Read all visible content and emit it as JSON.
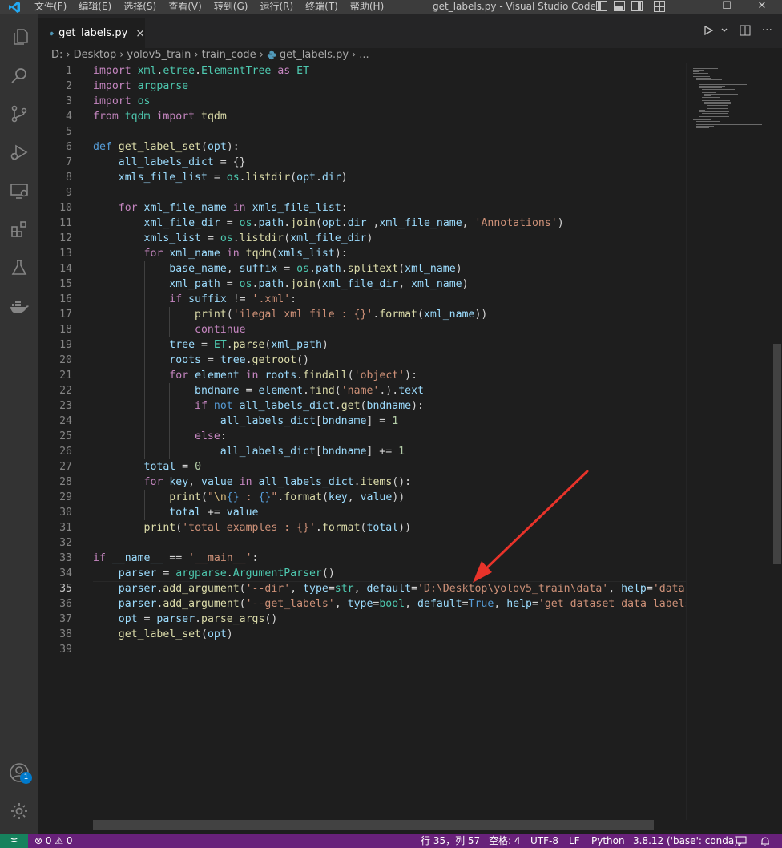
{
  "titlebar": {
    "menus": [
      "文件(F)",
      "编辑(E)",
      "选择(S)",
      "查看(V)",
      "转到(G)",
      "运行(R)",
      "终端(T)",
      "帮助(H)"
    ],
    "title": "get_labels.py - Visual Studio Code",
    "icons": [
      "vscode-logo-icon",
      "toggle-sidebar-icon",
      "toggle-panel-icon",
      "toggle-secondary-sidebar-icon",
      "customize-layout-icon",
      "minimize-icon",
      "maximize-icon",
      "close-icon"
    ]
  },
  "activitybar": {
    "items": [
      "explorer-icon",
      "search-icon",
      "source-control-icon",
      "run-debug-icon",
      "remote-explorer-icon",
      "extensions-icon",
      "testing-icon",
      "docker-icon"
    ],
    "bottom": [
      "accounts-icon",
      "manage-gear-icon"
    ],
    "accounts_badge": "1"
  },
  "tab": {
    "label": "get_labels.py",
    "close": "×"
  },
  "breadcrumb": [
    "D:",
    "Desktop",
    "yolov5_train",
    "train_code",
    "get_labels.py",
    "..."
  ],
  "editor": {
    "current_line": 35
  },
  "code_lines": [
    [
      [
        "kw",
        "import"
      ],
      [
        "pl",
        " "
      ],
      [
        "cls",
        "xml"
      ],
      [
        "pl",
        "."
      ],
      [
        "cls",
        "etree"
      ],
      [
        "pl",
        "."
      ],
      [
        "cls",
        "ElementTree"
      ],
      [
        "pl",
        " "
      ],
      [
        "kw",
        "as"
      ],
      [
        "pl",
        " "
      ],
      [
        "cls",
        "ET"
      ]
    ],
    [
      [
        "kw",
        "import"
      ],
      [
        "pl",
        " "
      ],
      [
        "cls",
        "argparse"
      ]
    ],
    [
      [
        "kw",
        "import"
      ],
      [
        "pl",
        " "
      ],
      [
        "cls",
        "os"
      ]
    ],
    [
      [
        "kw",
        "from"
      ],
      [
        "pl",
        " "
      ],
      [
        "cls",
        "tqdm"
      ],
      [
        "pl",
        " "
      ],
      [
        "kw",
        "import"
      ],
      [
        "pl",
        " "
      ],
      [
        "fn",
        "tqdm"
      ]
    ],
    [],
    [
      [
        "kw2",
        "def"
      ],
      [
        "pl",
        " "
      ],
      [
        "fn",
        "get_label_set"
      ],
      [
        "pl",
        "("
      ],
      [
        "var",
        "opt"
      ],
      [
        "pl",
        "):"
      ]
    ],
    [
      [
        "pl",
        "    "
      ],
      [
        "var",
        "all_labels_dict"
      ],
      [
        "pl",
        " = {}"
      ]
    ],
    [
      [
        "pl",
        "    "
      ],
      [
        "var",
        "xmls_file_list"
      ],
      [
        "pl",
        " = "
      ],
      [
        "cls",
        "os"
      ],
      [
        "pl",
        "."
      ],
      [
        "fn",
        "listdir"
      ],
      [
        "pl",
        "("
      ],
      [
        "var",
        "opt"
      ],
      [
        "pl",
        "."
      ],
      [
        "var",
        "dir"
      ],
      [
        "pl",
        ")"
      ]
    ],
    [],
    [
      [
        "pl",
        "    "
      ],
      [
        "kw",
        "for"
      ],
      [
        "pl",
        " "
      ],
      [
        "var",
        "xml_file_name"
      ],
      [
        "pl",
        " "
      ],
      [
        "kw",
        "in"
      ],
      [
        "pl",
        " "
      ],
      [
        "var",
        "xmls_file_list"
      ],
      [
        "pl",
        ":"
      ]
    ],
    [
      [
        "pl",
        "        "
      ],
      [
        "var",
        "xml_file_dir"
      ],
      [
        "pl",
        " = "
      ],
      [
        "cls",
        "os"
      ],
      [
        "pl",
        "."
      ],
      [
        "var",
        "path"
      ],
      [
        "pl",
        "."
      ],
      [
        "fn",
        "join"
      ],
      [
        "pl",
        "("
      ],
      [
        "var",
        "opt"
      ],
      [
        "pl",
        "."
      ],
      [
        "var",
        "dir"
      ],
      [
        "pl",
        " ,"
      ],
      [
        "var",
        "xml_file_name"
      ],
      [
        "pl",
        ", "
      ],
      [
        "str",
        "'Annotations'"
      ],
      [
        "pl",
        ")"
      ]
    ],
    [
      [
        "pl",
        "        "
      ],
      [
        "var",
        "xmls_list"
      ],
      [
        "pl",
        " = "
      ],
      [
        "cls",
        "os"
      ],
      [
        "pl",
        "."
      ],
      [
        "fn",
        "listdir"
      ],
      [
        "pl",
        "("
      ],
      [
        "var",
        "xml_file_dir"
      ],
      [
        "pl",
        ")"
      ]
    ],
    [
      [
        "pl",
        "        "
      ],
      [
        "kw",
        "for"
      ],
      [
        "pl",
        " "
      ],
      [
        "var",
        "xml_name"
      ],
      [
        "pl",
        " "
      ],
      [
        "kw",
        "in"
      ],
      [
        "pl",
        " "
      ],
      [
        "fn",
        "tqdm"
      ],
      [
        "pl",
        "("
      ],
      [
        "var",
        "xmls_list"
      ],
      [
        "pl",
        "):"
      ]
    ],
    [
      [
        "pl",
        "            "
      ],
      [
        "var",
        "base_name"
      ],
      [
        "pl",
        ", "
      ],
      [
        "var",
        "suffix"
      ],
      [
        "pl",
        " = "
      ],
      [
        "cls",
        "os"
      ],
      [
        "pl",
        "."
      ],
      [
        "var",
        "path"
      ],
      [
        "pl",
        "."
      ],
      [
        "fn",
        "splitext"
      ],
      [
        "pl",
        "("
      ],
      [
        "var",
        "xml_name"
      ],
      [
        "pl",
        ")"
      ]
    ],
    [
      [
        "pl",
        "            "
      ],
      [
        "var",
        "xml_path"
      ],
      [
        "pl",
        " = "
      ],
      [
        "cls",
        "os"
      ],
      [
        "pl",
        "."
      ],
      [
        "var",
        "path"
      ],
      [
        "pl",
        "."
      ],
      [
        "fn",
        "join"
      ],
      [
        "pl",
        "("
      ],
      [
        "var",
        "xml_file_dir"
      ],
      [
        "pl",
        ", "
      ],
      [
        "var",
        "xml_name"
      ],
      [
        "pl",
        ")"
      ]
    ],
    [
      [
        "pl",
        "            "
      ],
      [
        "kw",
        "if"
      ],
      [
        "pl",
        " "
      ],
      [
        "var",
        "suffix"
      ],
      [
        "pl",
        " != "
      ],
      [
        "str",
        "'.xml'"
      ],
      [
        "pl",
        ":"
      ]
    ],
    [
      [
        "pl",
        "                "
      ],
      [
        "fn",
        "print"
      ],
      [
        "pl",
        "("
      ],
      [
        "str",
        "'ilegal xml file : {}'"
      ],
      [
        "pl",
        "."
      ],
      [
        "fn",
        "format"
      ],
      [
        "pl",
        "("
      ],
      [
        "var",
        "xml_name"
      ],
      [
        "pl",
        "))"
      ]
    ],
    [
      [
        "pl",
        "                "
      ],
      [
        "kw",
        "continue"
      ]
    ],
    [
      [
        "pl",
        "            "
      ],
      [
        "var",
        "tree"
      ],
      [
        "pl",
        " = "
      ],
      [
        "cls",
        "ET"
      ],
      [
        "pl",
        "."
      ],
      [
        "fn",
        "parse"
      ],
      [
        "pl",
        "("
      ],
      [
        "var",
        "xml_path"
      ],
      [
        "pl",
        ")"
      ]
    ],
    [
      [
        "pl",
        "            "
      ],
      [
        "var",
        "roots"
      ],
      [
        "pl",
        " = "
      ],
      [
        "var",
        "tree"
      ],
      [
        "pl",
        "."
      ],
      [
        "fn",
        "getroot"
      ],
      [
        "pl",
        "()"
      ]
    ],
    [
      [
        "pl",
        "            "
      ],
      [
        "kw",
        "for"
      ],
      [
        "pl",
        " "
      ],
      [
        "var",
        "element"
      ],
      [
        "pl",
        " "
      ],
      [
        "kw",
        "in"
      ],
      [
        "pl",
        " "
      ],
      [
        "var",
        "roots"
      ],
      [
        "pl",
        "."
      ],
      [
        "fn",
        "findall"
      ],
      [
        "pl",
        "("
      ],
      [
        "str",
        "'object'"
      ],
      [
        "pl",
        "):"
      ]
    ],
    [
      [
        "pl",
        "                "
      ],
      [
        "var",
        "bndname"
      ],
      [
        "pl",
        " = "
      ],
      [
        "var",
        "element"
      ],
      [
        "pl",
        "."
      ],
      [
        "fn",
        "find"
      ],
      [
        "pl",
        "("
      ],
      [
        "str",
        "'name'"
      ],
      [
        "pl",
        "."
      ],
      [
        "pl",
        ")"
      ],
      [
        "pl",
        "."
      ],
      [
        "var",
        "text"
      ]
    ],
    [
      [
        "pl",
        "                "
      ],
      [
        "kw",
        "if"
      ],
      [
        "pl",
        " "
      ],
      [
        "kw2",
        "not"
      ],
      [
        "pl",
        " "
      ],
      [
        "var",
        "all_labels_dict"
      ],
      [
        "pl",
        "."
      ],
      [
        "fn",
        "get"
      ],
      [
        "pl",
        "("
      ],
      [
        "var",
        "bndname"
      ],
      [
        "pl",
        "):"
      ]
    ],
    [
      [
        "pl",
        "                    "
      ],
      [
        "var",
        "all_labels_dict"
      ],
      [
        "pl",
        "["
      ],
      [
        "var",
        "bndname"
      ],
      [
        "pl",
        "] = "
      ],
      [
        "num",
        "1"
      ]
    ],
    [
      [
        "pl",
        "                "
      ],
      [
        "kw",
        "else"
      ],
      [
        "pl",
        ":"
      ]
    ],
    [
      [
        "pl",
        "                    "
      ],
      [
        "var",
        "all_labels_dict"
      ],
      [
        "pl",
        "["
      ],
      [
        "var",
        "bndname"
      ],
      [
        "pl",
        "] += "
      ],
      [
        "num",
        "1"
      ]
    ],
    [
      [
        "pl",
        "        "
      ],
      [
        "var",
        "total"
      ],
      [
        "pl",
        " = "
      ],
      [
        "num",
        "0"
      ]
    ],
    [
      [
        "pl",
        "        "
      ],
      [
        "kw",
        "for"
      ],
      [
        "pl",
        " "
      ],
      [
        "var",
        "key"
      ],
      [
        "pl",
        ", "
      ],
      [
        "var",
        "value"
      ],
      [
        "pl",
        " "
      ],
      [
        "kw",
        "in"
      ],
      [
        "pl",
        " "
      ],
      [
        "var",
        "all_labels_dict"
      ],
      [
        "pl",
        "."
      ],
      [
        "fn",
        "items"
      ],
      [
        "pl",
        "():"
      ]
    ],
    [
      [
        "pl",
        "            "
      ],
      [
        "fn",
        "print"
      ],
      [
        "pl",
        "("
      ],
      [
        "str",
        "\""
      ],
      [
        "esc",
        "\\n"
      ],
      [
        "kw2",
        "{}"
      ],
      [
        "str",
        " : "
      ],
      [
        "kw2",
        "{}"
      ],
      [
        "str",
        "\""
      ],
      [
        "pl",
        "."
      ],
      [
        "fn",
        "format"
      ],
      [
        "pl",
        "("
      ],
      [
        "var",
        "key"
      ],
      [
        "pl",
        ", "
      ],
      [
        "var",
        "value"
      ],
      [
        "pl",
        "))"
      ]
    ],
    [
      [
        "pl",
        "            "
      ],
      [
        "var",
        "total"
      ],
      [
        "pl",
        " += "
      ],
      [
        "var",
        "value"
      ]
    ],
    [
      [
        "pl",
        "        "
      ],
      [
        "fn",
        "print"
      ],
      [
        "pl",
        "("
      ],
      [
        "str",
        "'total examples : {}'"
      ],
      [
        "pl",
        "."
      ],
      [
        "fn",
        "format"
      ],
      [
        "pl",
        "("
      ],
      [
        "var",
        "total"
      ],
      [
        "pl",
        "))"
      ]
    ],
    [],
    [
      [
        "kw",
        "if"
      ],
      [
        "pl",
        " "
      ],
      [
        "var",
        "__name__"
      ],
      [
        "pl",
        " == "
      ],
      [
        "str",
        "'__main__'"
      ],
      [
        "pl",
        ":"
      ]
    ],
    [
      [
        "pl",
        "    "
      ],
      [
        "var",
        "parser"
      ],
      [
        "pl",
        " = "
      ],
      [
        "cls",
        "argparse"
      ],
      [
        "pl",
        "."
      ],
      [
        "cls",
        "ArgumentParser"
      ],
      [
        "pl",
        "()"
      ]
    ],
    [
      [
        "pl",
        "    "
      ],
      [
        "var",
        "parser"
      ],
      [
        "pl",
        "."
      ],
      [
        "fn",
        "add_argument"
      ],
      [
        "pl",
        "("
      ],
      [
        "str",
        "'--dir'"
      ],
      [
        "pl",
        ", "
      ],
      [
        "var",
        "type"
      ],
      [
        "pl",
        "="
      ],
      [
        "cls",
        "str"
      ],
      [
        "pl",
        ", "
      ],
      [
        "var",
        "default"
      ],
      [
        "pl",
        "="
      ],
      [
        "str",
        "'D:\\Desktop\\yolov5_train\\data'"
      ],
      [
        "pl",
        ", "
      ],
      [
        "var",
        "help"
      ],
      [
        "pl",
        "="
      ],
      [
        "str",
        "'data dir"
      ]
    ],
    [
      [
        "pl",
        "    "
      ],
      [
        "var",
        "parser"
      ],
      [
        "pl",
        "."
      ],
      [
        "fn",
        "add_argument"
      ],
      [
        "pl",
        "("
      ],
      [
        "str",
        "'--get_labels'"
      ],
      [
        "pl",
        ", "
      ],
      [
        "var",
        "type"
      ],
      [
        "pl",
        "="
      ],
      [
        "cls",
        "bool"
      ],
      [
        "pl",
        ", "
      ],
      [
        "var",
        "default"
      ],
      [
        "pl",
        "="
      ],
      [
        "kw2",
        "True"
      ],
      [
        "pl",
        ", "
      ],
      [
        "var",
        "help"
      ],
      [
        "pl",
        "="
      ],
      [
        "str",
        "'get dataset data labels'"
      ],
      [
        "pl",
        ")"
      ]
    ],
    [
      [
        "pl",
        "    "
      ],
      [
        "var",
        "opt"
      ],
      [
        "pl",
        " = "
      ],
      [
        "var",
        "parser"
      ],
      [
        "pl",
        "."
      ],
      [
        "fn",
        "parse_args"
      ],
      [
        "pl",
        "()"
      ]
    ],
    [
      [
        "pl",
        "    "
      ],
      [
        "fn",
        "get_label_set"
      ],
      [
        "pl",
        "("
      ],
      [
        "var",
        "opt"
      ],
      [
        "pl",
        ")"
      ]
    ],
    []
  ],
  "statusbar": {
    "remote": "≍",
    "problems": "⊗ 0 ⚠ 0",
    "position": "行 35，列 57",
    "spaces": "空格: 4",
    "encoding": "UTF-8",
    "eol": "LF",
    "language": "Python",
    "interpreter": "3.8.12 ('base': conda)"
  },
  "colors": {
    "accent": "#007acc",
    "statusbar": "#68217a",
    "remote": "#16825d",
    "annotation_arrow": "#e8332a"
  },
  "annotation": {
    "type": "arrow",
    "color": "red"
  }
}
